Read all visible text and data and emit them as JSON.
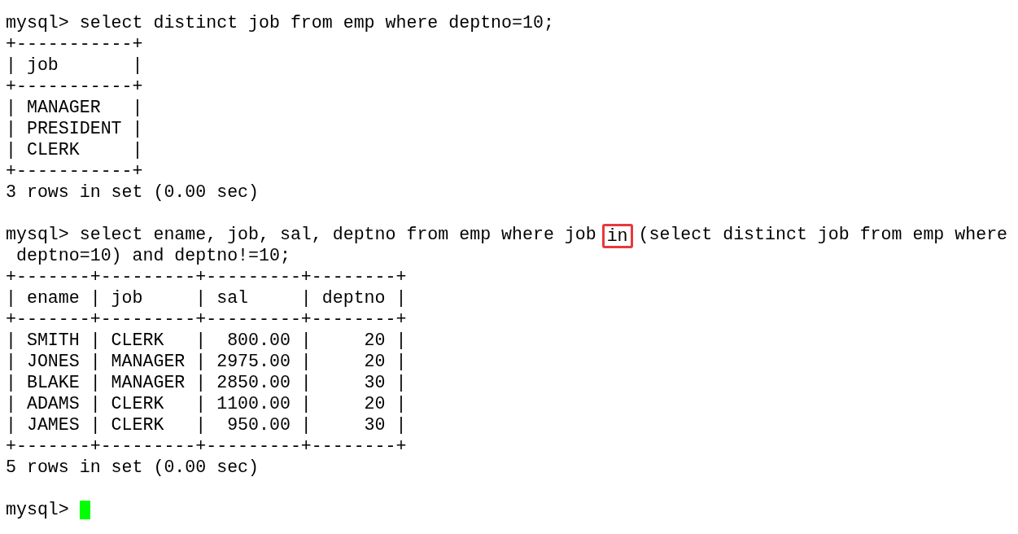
{
  "terminal": {
    "lines": [
      {
        "kind": "text",
        "text": "mysql> select distinct job from emp where deptno=10;"
      },
      {
        "kind": "text",
        "text": "+-----------+"
      },
      {
        "kind": "text",
        "text": "| job       |"
      },
      {
        "kind": "text",
        "text": "+-----------+"
      },
      {
        "kind": "text",
        "text": "| MANAGER   |"
      },
      {
        "kind": "text",
        "text": "| PRESIDENT |"
      },
      {
        "kind": "text",
        "text": "| CLERK     |"
      },
      {
        "kind": "text",
        "text": "+-----------+"
      },
      {
        "kind": "text",
        "text": "3 rows in set (0.00 sec)"
      },
      {
        "kind": "blank"
      },
      {
        "kind": "segments",
        "segments": [
          {
            "text": "mysql> select ename, job, sal, deptno from emp where job ",
            "boxed": false
          },
          {
            "text": "in",
            "boxed": true
          },
          {
            "text": " (select distinct job from emp where",
            "boxed": false
          }
        ]
      },
      {
        "kind": "text",
        "text": " deptno=10) and deptno!=10;"
      },
      {
        "kind": "text",
        "text": "+-------+---------+---------+--------+"
      },
      {
        "kind": "text",
        "text": "| ename | job     | sal     | deptno |"
      },
      {
        "kind": "text",
        "text": "+-------+---------+---------+--------+"
      },
      {
        "kind": "text",
        "text": "| SMITH | CLERK   |  800.00 |     20 |"
      },
      {
        "kind": "text",
        "text": "| JONES | MANAGER | 2975.00 |     20 |"
      },
      {
        "kind": "text",
        "text": "| BLAKE | MANAGER | 2850.00 |     30 |"
      },
      {
        "kind": "text",
        "text": "| ADAMS | CLERK   | 1100.00 |     20 |"
      },
      {
        "kind": "text",
        "text": "| JAMES | CLERK   |  950.00 |     30 |"
      },
      {
        "kind": "text",
        "text": "+-------+---------+---------+--------+"
      },
      {
        "kind": "text",
        "text": "5 rows in set (0.00 sec)"
      },
      {
        "kind": "blank"
      },
      {
        "kind": "prompt",
        "text": "mysql>",
        "cursor": true
      }
    ]
  }
}
